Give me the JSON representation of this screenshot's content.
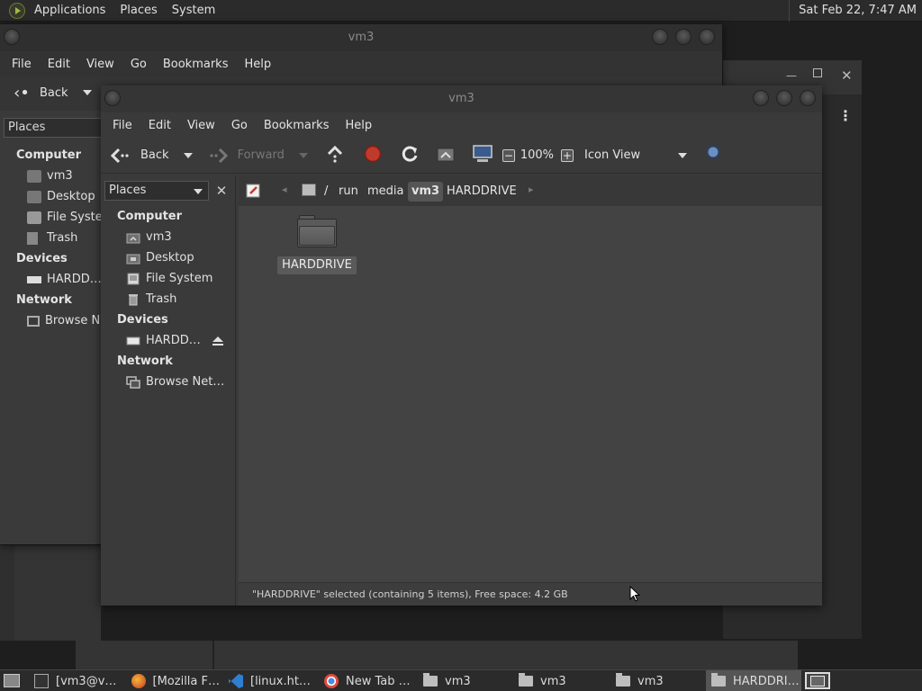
{
  "top_panel": {
    "menu": [
      "Applications",
      "Places",
      "System"
    ],
    "clock": "Sat Feb 22,  7:47 AM"
  },
  "back_window": {
    "title": "vm3",
    "menu": [
      "File",
      "Edit",
      "View",
      "Go",
      "Bookmarks",
      "Help"
    ],
    "back_label": "Back",
    "places_label": "Places",
    "sidebar": {
      "computer_heading": "Computer",
      "items_computer": [
        "vm3",
        "Desktop",
        "File System",
        "Trash"
      ],
      "devices_heading": "Devices",
      "items_devices": [
        "HARDD…"
      ],
      "network_heading": "Network",
      "items_network": [
        "Browse Network"
      ]
    }
  },
  "front_window": {
    "title": "vm3",
    "menu": [
      "File",
      "Edit",
      "View",
      "Go",
      "Bookmarks",
      "Help"
    ],
    "toolbar": {
      "back_label": "Back",
      "forward_label": "Forward",
      "zoom_level": "100%",
      "view_mode": "Icon View"
    },
    "sidebar": {
      "places_label": "Places",
      "computer_heading": "Computer",
      "items_computer": [
        "vm3",
        "Desktop",
        "File System",
        "Trash"
      ],
      "devices_heading": "Devices",
      "items_devices": [
        "HARDD…"
      ],
      "network_heading": "Network",
      "items_network": [
        "Browse Net…"
      ]
    },
    "path": [
      "/",
      "run",
      "media",
      "vm3",
      "HARDDRIVE"
    ],
    "active_crumb": "vm3",
    "content": {
      "items": [
        {
          "name": "HARDDRIVE",
          "type": "folder",
          "selected": true
        }
      ]
    },
    "status": "\"HARDDRIVE\" selected (containing 5 items), Free space: 4.2 GB"
  },
  "taskbar": {
    "items": [
      "[vm3@v…",
      "[Mozilla F…",
      "[linux.ht…",
      "New Tab …",
      "vm3",
      "vm3",
      "vm3",
      "HARDDRI…"
    ]
  },
  "colors": {
    "panel_bg": "#2b2b2b",
    "window_bg": "#3a3a3a",
    "content_bg": "#434343",
    "selected_bg": "#5a5a5a",
    "stop_red": "#c0392b"
  }
}
